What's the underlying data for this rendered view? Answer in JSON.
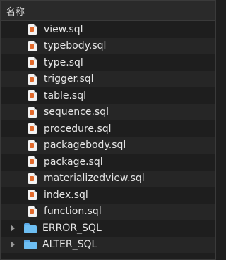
{
  "header": {
    "title": "名称"
  },
  "files": [
    {
      "name": "view.sql"
    },
    {
      "name": "typebody.sql"
    },
    {
      "name": "type.sql"
    },
    {
      "name": "trigger.sql"
    },
    {
      "name": "table.sql"
    },
    {
      "name": "sequence.sql"
    },
    {
      "name": "procedure.sql"
    },
    {
      "name": "packagebody.sql"
    },
    {
      "name": "package.sql"
    },
    {
      "name": "materializedview.sql"
    },
    {
      "name": "index.sql"
    },
    {
      "name": "function.sql"
    }
  ],
  "folders": [
    {
      "name": "ERROR_SQL"
    },
    {
      "name": "ALTER_SQL"
    }
  ],
  "colors": {
    "background": "#1e1e1e",
    "stripe": "#262626",
    "folder": "#6dbef2",
    "file_mark": "#e26a2c"
  },
  "icons": {
    "file": "sql-file-icon",
    "folder": "folder-icon",
    "expander": "chevron-right-icon"
  }
}
